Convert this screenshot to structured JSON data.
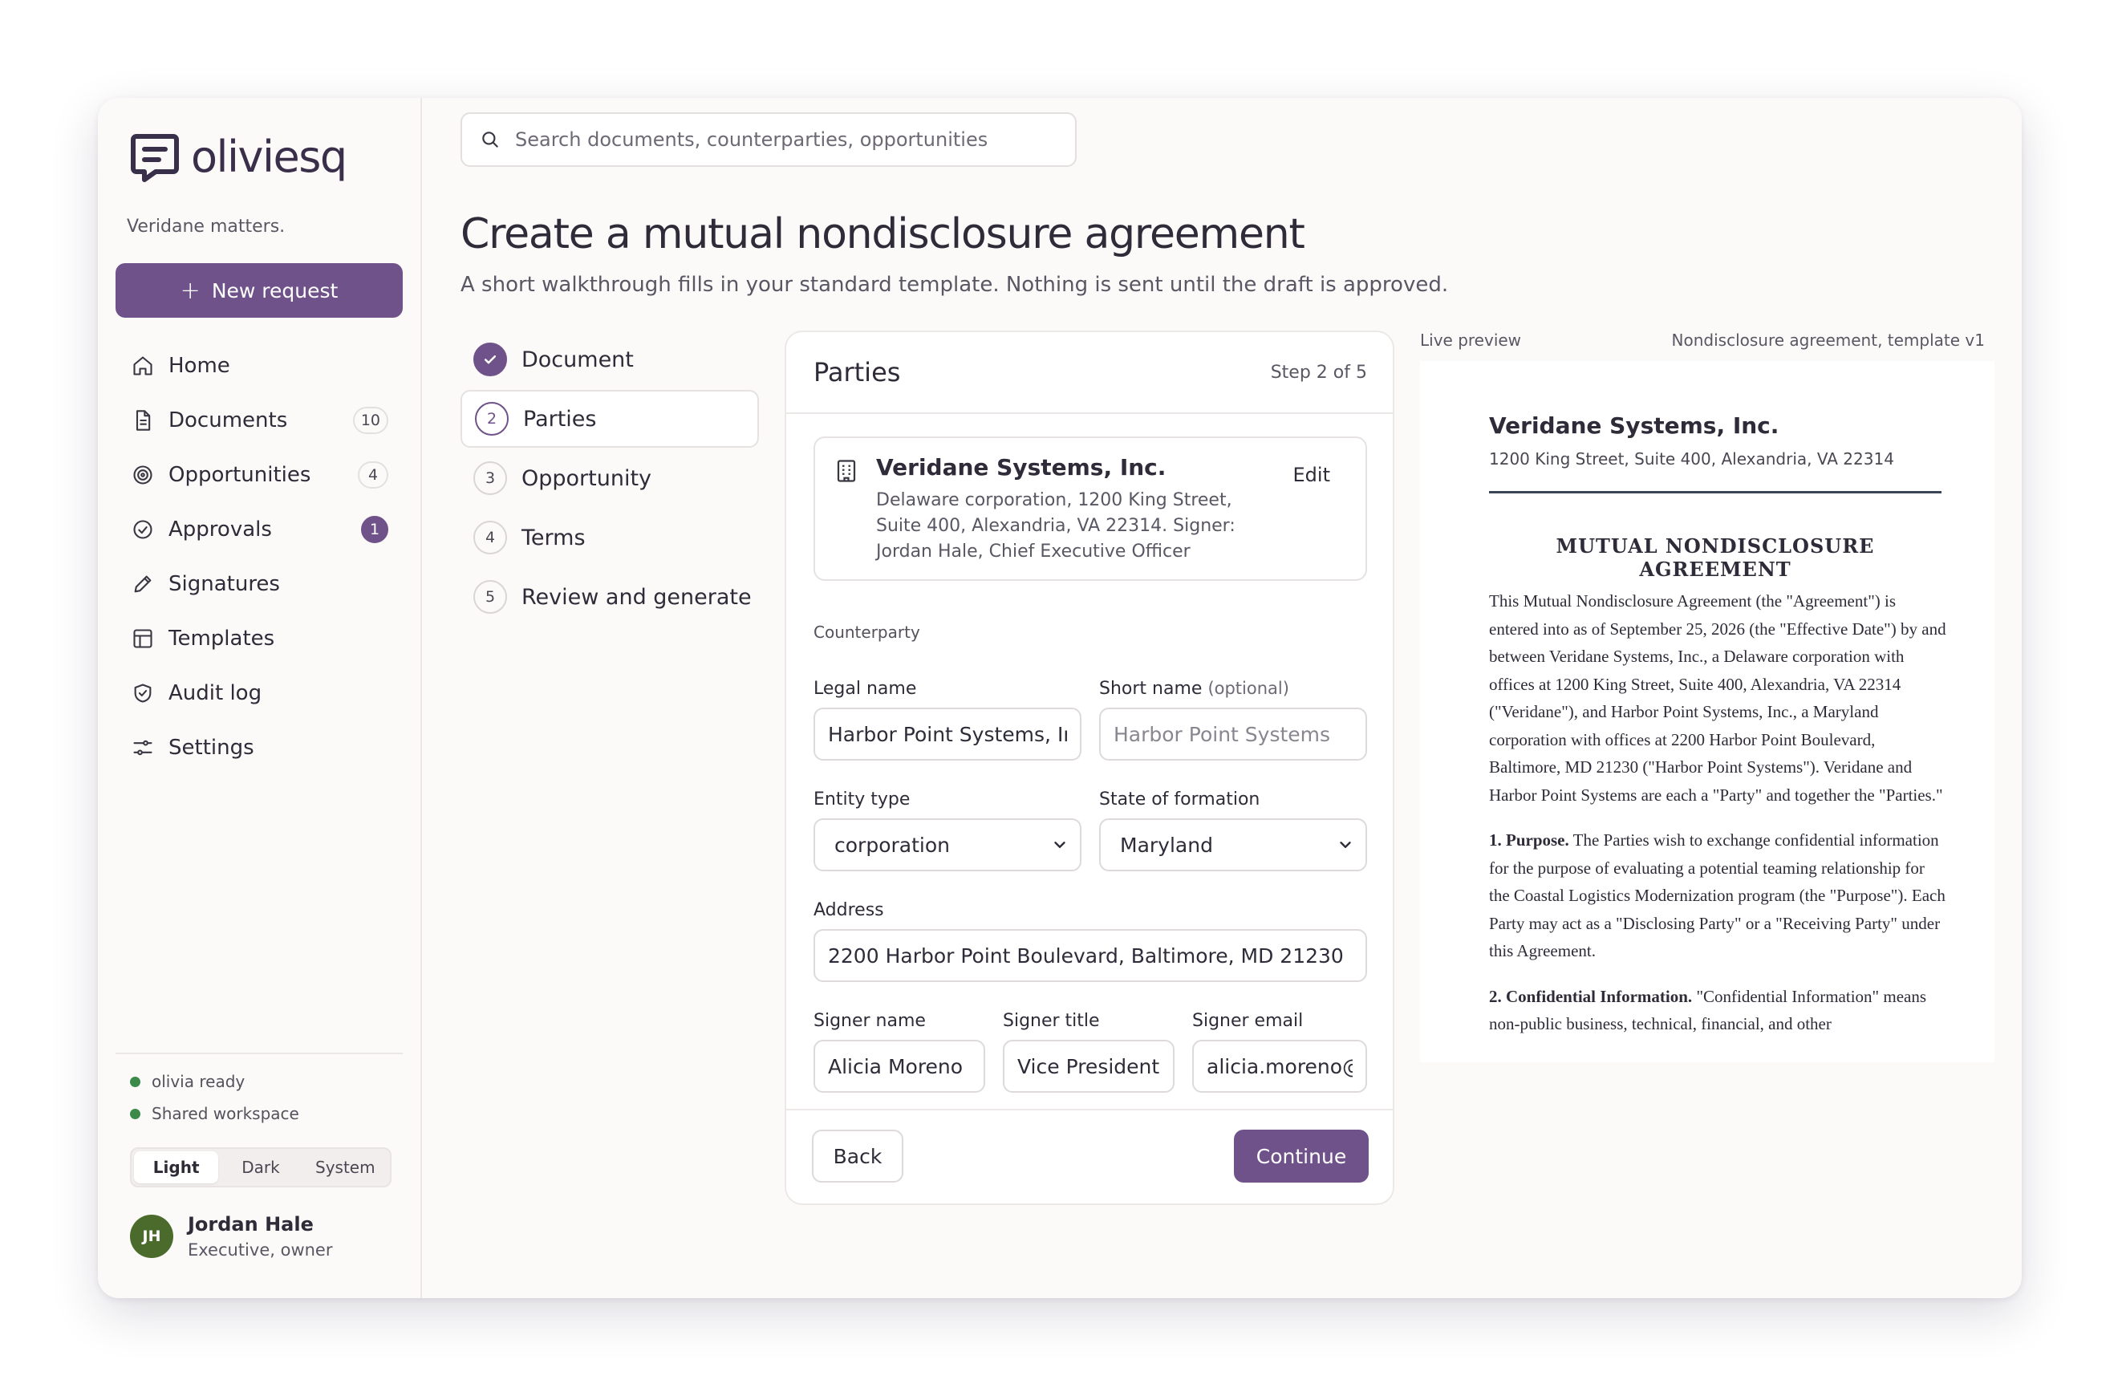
{
  "brand": {
    "name": "oliviesq",
    "tagline": "Veridane matters."
  },
  "sidebar": {
    "new_request": "New request",
    "items": [
      {
        "label": "Home",
        "icon": "home-icon",
        "badge": ""
      },
      {
        "label": "Documents",
        "icon": "document-icon",
        "badge": "10"
      },
      {
        "label": "Opportunities",
        "icon": "target-icon",
        "badge": "4"
      },
      {
        "label": "Approvals",
        "icon": "check-circle-icon",
        "badge": "1"
      },
      {
        "label": "Signatures",
        "icon": "pen-icon",
        "badge": ""
      },
      {
        "label": "Templates",
        "icon": "layout-icon",
        "badge": ""
      },
      {
        "label": "Audit log",
        "icon": "shield-check-icon",
        "badge": ""
      },
      {
        "label": "Settings",
        "icon": "sliders-icon",
        "badge": ""
      }
    ],
    "status": [
      "olivia ready",
      "Shared workspace"
    ],
    "theme": {
      "options": [
        "Light",
        "Dark",
        "System"
      ],
      "selected": "Light"
    },
    "user": {
      "initials": "JH",
      "name": "Jordan Hale",
      "role": "Executive, owner"
    }
  },
  "search": {
    "placeholder": "Search documents, counterparties, opportunities"
  },
  "page": {
    "title": "Create a mutual nondisclosure agreement",
    "subtitle": "A short walkthrough fills in your standard template. Nothing is sent until the draft is approved."
  },
  "steps": [
    {
      "num": "",
      "label": "Document",
      "state": "done"
    },
    {
      "num": "2",
      "label": "Parties",
      "state": "current"
    },
    {
      "num": "3",
      "label": "Opportunity",
      "state": "todo"
    },
    {
      "num": "4",
      "label": "Terms",
      "state": "todo"
    },
    {
      "num": "5",
      "label": "Review and generate",
      "state": "todo"
    }
  ],
  "form": {
    "title": "Parties",
    "step": "Step 2 of 5",
    "our_party": {
      "name": "Veridane Systems, Inc.",
      "desc": "Delaware corporation, 1200 King Street, Suite 400, Alexandria, VA 22314. Signer: Jordan Hale, Chief Executive Officer",
      "edit": "Edit"
    },
    "section": "Counterparty",
    "legal_name": {
      "label": "Legal name",
      "value": "Harbor Point Systems, Inc."
    },
    "short_name": {
      "label": "Short name",
      "optional": "(optional)",
      "placeholder": "Harbor Point Systems"
    },
    "entity_type": {
      "label": "Entity type",
      "value": "corporation"
    },
    "state": {
      "label": "State of formation",
      "value": "Maryland"
    },
    "address": {
      "label": "Address",
      "value": "2200 Harbor Point Boulevard, Baltimore, MD 21230"
    },
    "signer_name": {
      "label": "Signer name",
      "value": "Alicia Moreno"
    },
    "signer_title": {
      "label": "Signer title",
      "value": "Vice President"
    },
    "signer_email": {
      "label": "Signer email",
      "value": "alicia.moreno@harborpoint.com"
    },
    "back": "Back",
    "continue": "Continue"
  },
  "preview": {
    "label": "Live preview",
    "template": "Nondisclosure agreement, template v1",
    "company": "Veridane Systems, Inc.",
    "address": "1200 King Street, Suite 400, Alexandria, VA 22314",
    "doc_title": "MUTUAL NONDISCLOSURE AGREEMENT",
    "intro": "This Mutual Nondisclosure Agreement (the \"Agreement\") is entered into as of September 25, 2026 (the \"Effective Date\") by and between Veridane Systems, Inc., a Delaware corporation with offices at 1200 King Street, Suite 400, Alexandria, VA 22314 (\"Veridane\"), and Harbor Point Systems, Inc., a Maryland corporation with offices at 2200 Harbor Point Boulevard, Baltimore, MD 21230 (\"Harbor Point Systems\"). Veridane and Harbor Point Systems are each a \"Party\" and together the \"Parties.\"",
    "s1_head": "1. Purpose.",
    "s1_body": "The Parties wish to exchange confidential information for the purpose of evaluating a potential teaming relationship for the Coastal Logistics Modernization program (the \"Purpose\"). Each Party may act as a \"Disclosing Party\" or a \"Receiving Party\" under this Agreement.",
    "s2_head": "2. Confidential Information.",
    "s2_body": "\"Confidential Information\" means non-public business, technical, financial, and other"
  },
  "colors": {
    "accent": "#6e5289",
    "ready": "#3b8a4a",
    "avatar": "#4a6b2c"
  }
}
